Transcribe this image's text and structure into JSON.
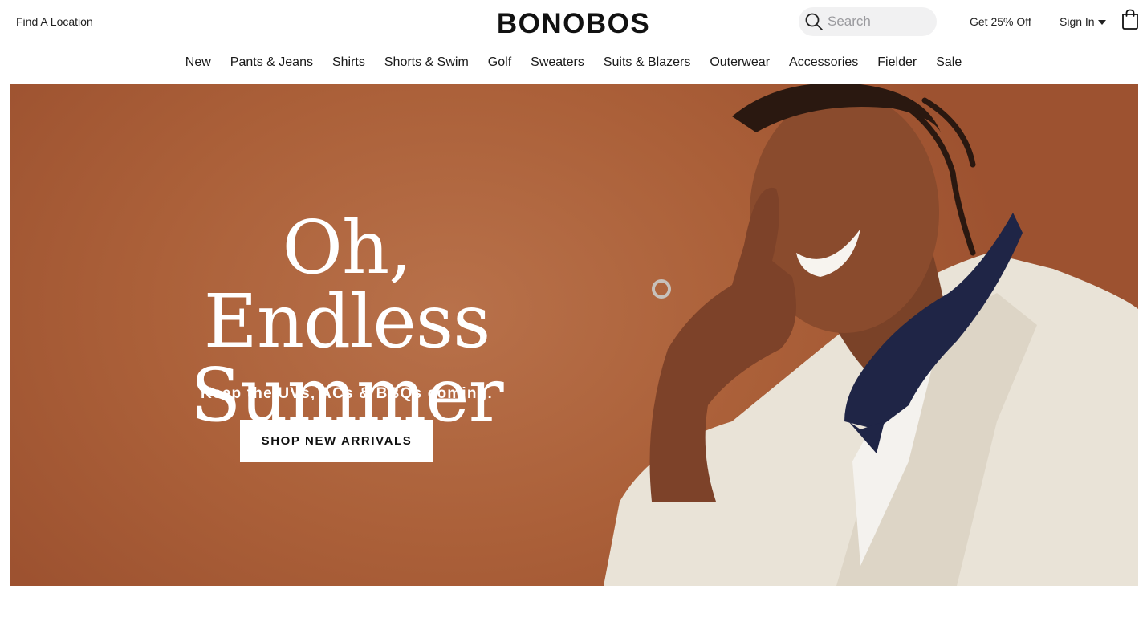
{
  "header": {
    "find_location": "Find A Location",
    "logo": "BONOBOS",
    "search_placeholder": "Search",
    "promo": "Get 25% Off",
    "sign_in": "Sign In"
  },
  "nav": {
    "items": [
      "New",
      "Pants & Jeans",
      "Shirts",
      "Shorts & Swim",
      "Golf",
      "Sweaters",
      "Suits & Blazers",
      "Outerwear",
      "Accessories",
      "Fielder",
      "Sale"
    ]
  },
  "hero": {
    "title_line1": "Oh, Endless",
    "title_line2": "Summer",
    "subtitle": "Keep the UVs, ACs & BBQs coming.",
    "cta": "SHOP NEW ARRIVALS",
    "background_color": "#ab6039"
  },
  "icons": {
    "search": "search-icon",
    "caret": "caret-down-icon",
    "bag": "shopping-bag-icon"
  }
}
